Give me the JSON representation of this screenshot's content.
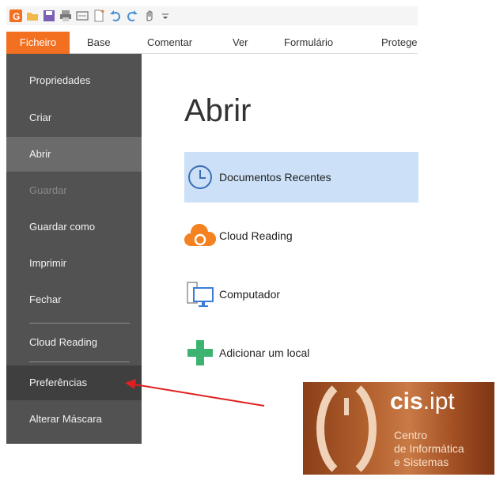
{
  "menubar": {
    "tabs": [
      {
        "label": "Ficheiro",
        "active": true
      },
      {
        "label": "Base"
      },
      {
        "label": "Comentar"
      },
      {
        "label": "Ver"
      },
      {
        "label": "Formulário"
      },
      {
        "label": "Protege"
      }
    ]
  },
  "quick_access": {
    "icons": [
      "app-logo-icon",
      "open-folder-icon",
      "save-icon",
      "print-icon",
      "scan-icon",
      "new-doc-icon",
      "undo-icon",
      "redo-icon",
      "hand-tool-icon",
      "customize-arrow-icon"
    ]
  },
  "sidebar": {
    "items": [
      {
        "label": "Propriedades"
      },
      {
        "label": "Criar"
      },
      {
        "label": "Abrir",
        "state": "selected"
      },
      {
        "label": "Guardar",
        "state": "disabled"
      },
      {
        "label": "Guardar como"
      },
      {
        "label": "Imprimir"
      },
      {
        "label": "Fechar"
      },
      {
        "label": "Cloud Reading"
      },
      {
        "label": "Preferências",
        "state": "hover"
      },
      {
        "label": "Alterar Máscara"
      }
    ]
  },
  "main": {
    "title": "Abrir",
    "options": [
      {
        "label": "Documentos Recentes",
        "icon": "clock-icon",
        "selected": true
      },
      {
        "label": "Cloud Reading",
        "icon": "cloud-icon"
      },
      {
        "label": "Computador",
        "icon": "computer-icon"
      },
      {
        "label": "Adicionar um local",
        "icon": "plus-icon"
      }
    ]
  },
  "logo": {
    "brand_bold": "cis",
    "brand_rest": ".ipt",
    "lines": [
      "Centro",
      "de Informática",
      "e Sistemas"
    ]
  },
  "colors": {
    "accent": "#f37021",
    "sidebar_bg": "#525252",
    "selected_option_bg": "#cce0f7",
    "arrow": "#e02020",
    "plus": "#3cb371"
  }
}
